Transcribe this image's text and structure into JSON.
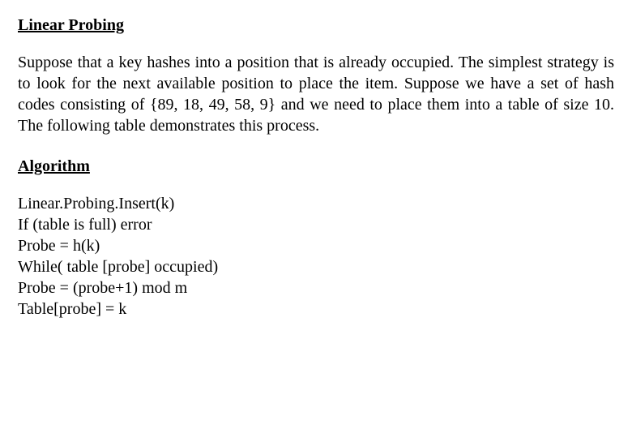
{
  "heading1": "Linear Probing",
  "paragraph1": "Suppose that a key hashes into a position that is already occupied. The simplest strategy is to look for the next available position to place the item. Suppose we have a set of hash codes consisting of {89, 18, 49, 58, 9} and we need to place them into a table of size 10. The following table demonstrates this process.",
  "heading2": "Algorithm",
  "code": {
    "l1": "Linear.Probing.Insert(k)",
    "l2": "If (table is full) error",
    "l3": "Probe = h(k)",
    "l4": "While( table [probe] occupied)",
    "l5": "Probe = (probe+1) mod m",
    "l6": "Table[probe] = k"
  }
}
